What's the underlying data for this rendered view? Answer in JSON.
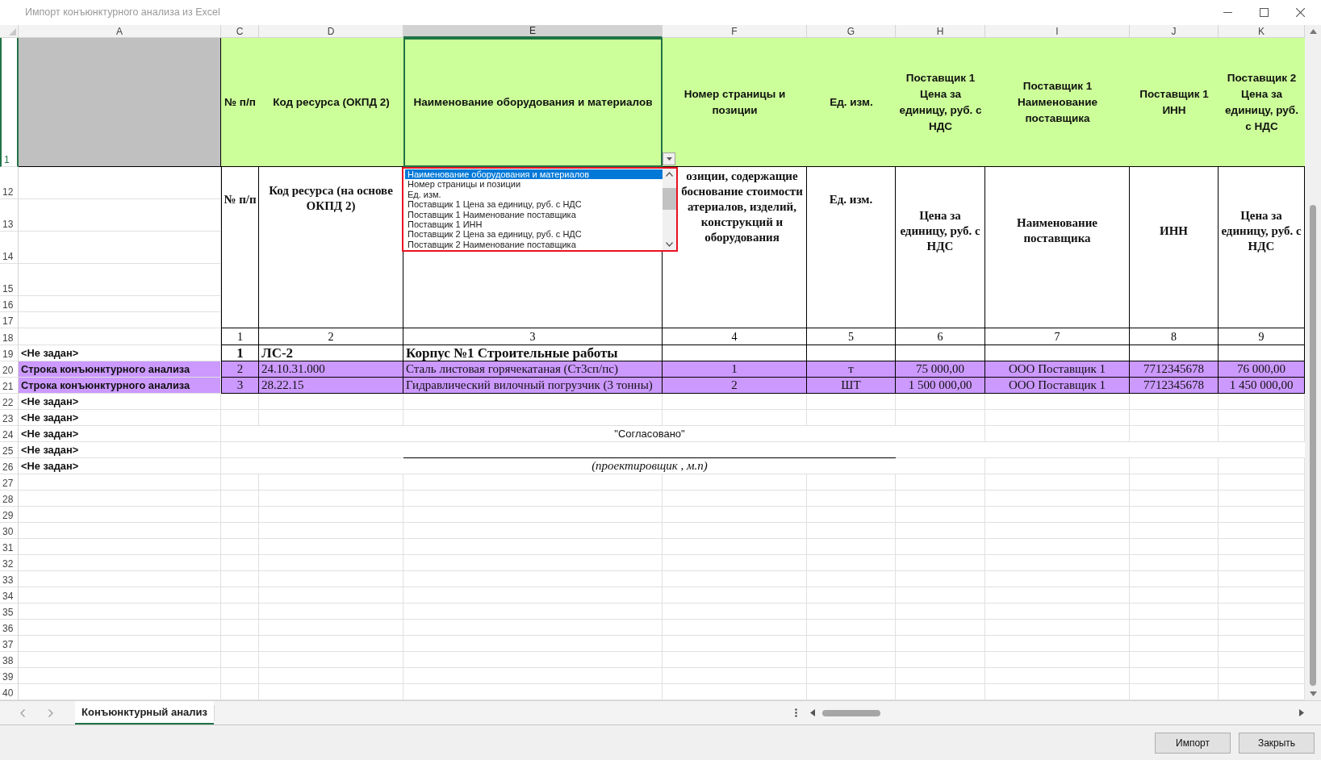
{
  "window": {
    "title": "Импорт конъюнктурного анализа из Excel"
  },
  "column_headers": [
    {
      "label": "A",
      "selected": false
    },
    {
      "label": "C",
      "selected": false
    },
    {
      "label": "D",
      "selected": false
    },
    {
      "label": "E",
      "selected": true
    },
    {
      "label": "F",
      "selected": false
    },
    {
      "label": "G",
      "selected": false
    },
    {
      "label": "H",
      "selected": false
    },
    {
      "label": "I",
      "selected": false
    },
    {
      "label": "J",
      "selected": false
    },
    {
      "label": "K",
      "selected": false
    }
  ],
  "row_numbers": [
    {
      "label": "1",
      "selected": true
    },
    {
      "label": "12",
      "selected": false
    },
    {
      "label": "13",
      "selected": false
    },
    {
      "label": "14",
      "selected": false
    },
    {
      "label": "15",
      "selected": false
    },
    {
      "label": "16",
      "selected": false
    },
    {
      "label": "17",
      "selected": false
    },
    {
      "label": "18",
      "selected": false
    },
    {
      "label": "19",
      "selected": false
    },
    {
      "label": "20",
      "selected": false
    },
    {
      "label": "21",
      "selected": false
    },
    {
      "label": "22",
      "selected": false
    },
    {
      "label": "23",
      "selected": false
    },
    {
      "label": "24",
      "selected": false
    },
    {
      "label": "25",
      "selected": false
    },
    {
      "label": "26",
      "selected": false
    },
    {
      "label": "27",
      "selected": false
    },
    {
      "label": "28",
      "selected": false
    },
    {
      "label": "29",
      "selected": false
    },
    {
      "label": "30",
      "selected": false
    },
    {
      "label": "31",
      "selected": false
    },
    {
      "label": "32",
      "selected": false
    },
    {
      "label": "33",
      "selected": false
    },
    {
      "label": "34",
      "selected": false
    },
    {
      "label": "35",
      "selected": false
    },
    {
      "label": "36",
      "selected": false
    },
    {
      "label": "37",
      "selected": false
    },
    {
      "label": "38",
      "selected": false
    },
    {
      "label": "39",
      "selected": false
    },
    {
      "label": "40",
      "selected": false
    }
  ],
  "header_cells": [
    "№ п/п",
    "Код ресурса (ОКПД 2)",
    "Наименование оборудования и материалов",
    "Номер страницы и позиции",
    "Ед. изм.",
    "Поставщик 1 Цена за единицу, руб. с НДС",
    "Поставщик 1 Наименование поставщика",
    "Поставщик 1 ИНН",
    "Поставщик 2 Цена за единицу, руб. с НДС"
  ],
  "description_cells": [
    {
      "kind": "text",
      "text": "№ п/п"
    },
    {
      "kind": "text",
      "text": "Код ресурса (на основе ОКПД 2)"
    },
    {
      "kind": "blank"
    },
    {
      "kind": "text",
      "text": "озиции, содержащие\nбоснование стоимости\nатериалов, изделий,\nконструкций и\nоборудования"
    },
    {
      "kind": "text",
      "text": "Ед. изм."
    },
    {
      "kind": "text",
      "text": "Цена за единицу, руб. с НДС"
    },
    {
      "kind": "text",
      "text": "Наименование поставщика"
    },
    {
      "kind": "text",
      "text": "ИНН"
    },
    {
      "kind": "text",
      "text": "Цена за единицу, руб. с НДС"
    }
  ],
  "column_numbers": [
    "1",
    "2",
    "3",
    "4",
    "5",
    "6",
    "7",
    "8",
    "9"
  ],
  "rows": [
    {
      "label": "<Не задан>",
      "kind": "section",
      "cells": [
        "1",
        "ЛС-2",
        "Корпус №1 Строительные работы"
      ]
    },
    {
      "label": "Строка конъюнктурного анализа",
      "kind": "item",
      "cells": [
        "2",
        "24.10.31.000",
        "Сталь листовая горячекатаная (Ст3сп/пс)",
        "1",
        "т",
        "75 000,00",
        "ООО Поставщик 1",
        "7712345678",
        "76 000,00"
      ]
    },
    {
      "label": "Строка конъюнктурного анализа",
      "kind": "item",
      "cells": [
        "3",
        "28.22.15",
        "Гидравлический вилочный погрузчик (3 тонны)",
        "2",
        "ШТ",
        "1 500 000,00",
        "ООО Поставщик 1",
        "7712345678",
        "1 450 000,00"
      ]
    }
  ],
  "unassigned_rows": [
    "<Не задан>",
    "<Не задан>",
    "<Не задан>",
    "<Не задан>",
    "<Не задан>"
  ],
  "signature": {
    "approval": "\"Согласовано\"",
    "caption": "(проектировщик , м.п)"
  },
  "dropdown": {
    "items": [
      {
        "label": "Наименование оборудования и материалов",
        "selected": true
      },
      {
        "label": "Номер страницы и позиции",
        "selected": false
      },
      {
        "label": "Ед. изм.",
        "selected": false
      },
      {
        "label": "Поставщик 1 Цена за единицу, руб. с НДС",
        "selected": false
      },
      {
        "label": "Поставщик 1 Наименование поставщика",
        "selected": false
      },
      {
        "label": "Поставщик 1 ИНН",
        "selected": false
      },
      {
        "label": "Поставщик 2 Цена за единицу, руб. с НДС",
        "selected": false
      },
      {
        "label": "Поставщик 2 Наименование поставщика",
        "selected": false
      }
    ]
  },
  "sheet_tabs": [
    {
      "label": "Конъюнктурный анализ",
      "selected": true
    }
  ],
  "buttons": [
    "Импорт",
    "Закрыть"
  ]
}
